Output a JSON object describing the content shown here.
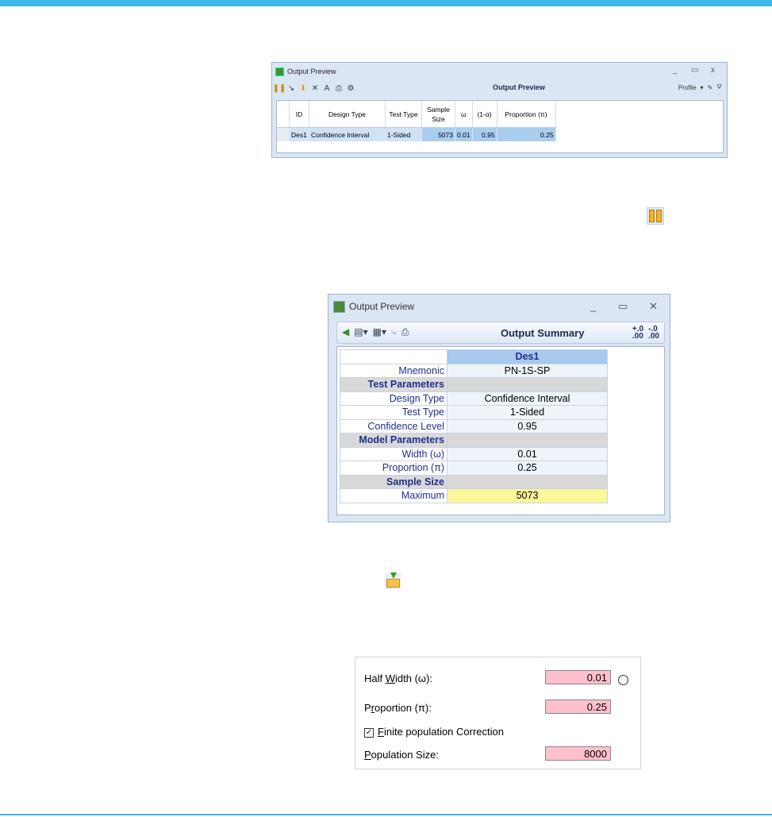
{
  "win1": {
    "title": "Output Preview",
    "toolbar_title": "Output Preview",
    "profile_label": "Profile",
    "columns": [
      "ID",
      "Design Type",
      "Test Type",
      "Sample Size",
      "ω",
      "(1-α)",
      "Proportion (π)"
    ],
    "row": [
      "Des1",
      "Confidence Interval",
      "1-Sided",
      "5073",
      "0.01",
      "0.95",
      "0.25"
    ],
    "controls": {
      "minimize": "_",
      "maximize": "▭",
      "close": "x"
    }
  },
  "win2": {
    "title": "Output Preview",
    "toolbar_title": "Output Summary",
    "controls": {
      "minimize": "_",
      "maximize": "▭",
      "close": "✕"
    },
    "column_header": "Des1",
    "rows": [
      {
        "label": "Mnemonic",
        "value": "PN-1S-SP",
        "type": "row"
      },
      {
        "label": "Test Parameters",
        "value": "",
        "type": "section"
      },
      {
        "label": "Design Type",
        "value": "Confidence Interval",
        "type": "row"
      },
      {
        "label": "Test Type",
        "value": "1-Sided",
        "type": "row"
      },
      {
        "label": "Confidence Level",
        "value": "0.95",
        "type": "row"
      },
      {
        "label": "Model Parameters",
        "value": "",
        "type": "section"
      },
      {
        "label": "Width (ω)",
        "value": "0.01",
        "type": "row"
      },
      {
        "label": "Proportion (π)",
        "value": "0.25",
        "type": "row"
      },
      {
        "label": "Sample Size",
        "value": "",
        "type": "section"
      },
      {
        "label": "Maximum",
        "value": "5073",
        "type": "highlight"
      }
    ],
    "decimal_buttons": [
      "+.0 .00",
      "-.0 .00"
    ]
  },
  "panel": {
    "half_width_label_pre": "Half ",
    "half_width_label_u": "W",
    "half_width_label_post": "idth (ω):",
    "half_width_value": "0.01",
    "proportion_label_pre": "P",
    "proportion_label_u": "r",
    "proportion_label_post": "oportion (π):",
    "proportion_value": "0.25",
    "fpc_label_u": "F",
    "fpc_label_post": "inite population Correction",
    "fpc_checked": true,
    "population_label_u": "P",
    "population_label_post": "opulation Size:",
    "population_value": "8000"
  },
  "colors": {
    "accent_bar": "#3bb7e8",
    "input_bg": "#ffc0cb",
    "highlight": "#fbf79a"
  }
}
